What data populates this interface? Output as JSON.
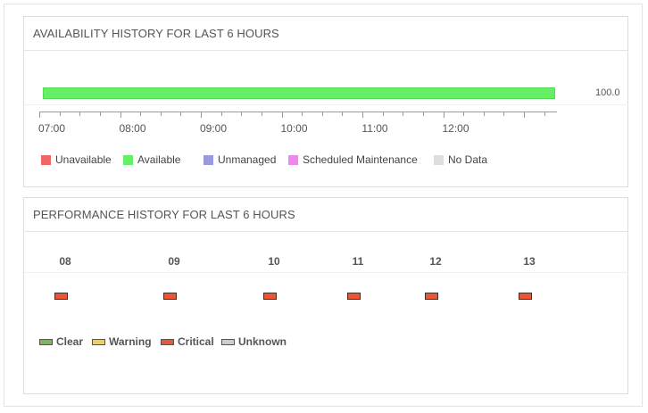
{
  "availability": {
    "title": "AVAILABILITY HISTORY FOR LAST 6 HOURS",
    "value_label": "100.0",
    "bar_status": "available",
    "available_fraction": 1.0,
    "time_ticks": [
      "07:00",
      "08:00",
      "09:00",
      "10:00",
      "11:00",
      "12:00"
    ],
    "legend": [
      {
        "label": "Unavailable",
        "color": "#ee6666"
      },
      {
        "label": "Available",
        "color": "#66ee66"
      },
      {
        "label": "Unmanaged",
        "color": "#9999dd"
      },
      {
        "label": "Scheduled Maintenance",
        "color": "#ee88ee"
      },
      {
        "label": "No Data",
        "color": "#dddddd"
      }
    ]
  },
  "performance": {
    "title": "PERFORMANCE HISTORY FOR LAST 6 HOURS",
    "hours": [
      {
        "label": "08",
        "status": "Critical"
      },
      {
        "label": "09",
        "status": "Critical"
      },
      {
        "label": "10",
        "status": "Critical"
      },
      {
        "label": "11",
        "status": "Critical"
      },
      {
        "label": "12",
        "status": "Critical"
      },
      {
        "label": "13",
        "status": "Critical"
      }
    ],
    "legend": [
      {
        "label": "Clear",
        "color": "#77bb55"
      },
      {
        "label": "Warning",
        "color": "#f5cc55"
      },
      {
        "label": "Critical",
        "color": "#ee5533"
      },
      {
        "label": "Unknown",
        "color": "#cccccc"
      }
    ]
  }
}
